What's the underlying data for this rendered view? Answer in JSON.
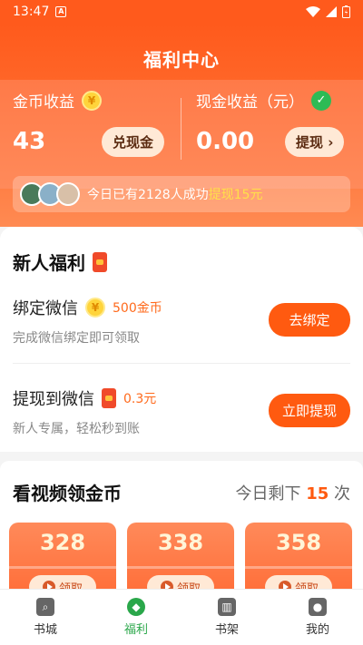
{
  "status": {
    "time": "13:47",
    "sim": "A"
  },
  "header": {
    "title": "福利中心"
  },
  "earnings": {
    "coin_label": "金币收益",
    "coin_value": "43",
    "coin_button": "兑现金",
    "cash_label": "现金收益（元）",
    "cash_value": "0.00",
    "cash_button": "提现 ›"
  },
  "marquee": {
    "text": "今日已有2128人成功",
    "highlight": "提现15元"
  },
  "newbie": {
    "title": "新人福利",
    "tasks": [
      {
        "name": "绑定微信",
        "reward": "500金币",
        "desc": "完成微信绑定即可领取",
        "button": "去绑定"
      },
      {
        "name": "提现到微信",
        "reward": "0.3元",
        "desc": "新人专属，轻松秒到账",
        "button": "立即提现"
      }
    ]
  },
  "video": {
    "title": "看视频领金币",
    "remain_prefix": "今日剩下",
    "remain_count": "15",
    "remain_suffix": "次",
    "cards": [
      {
        "amount": "328",
        "button": "领取"
      },
      {
        "amount": "338",
        "button": "领取"
      },
      {
        "amount": "358",
        "button": "领取"
      }
    ]
  },
  "tabbar": {
    "items": [
      {
        "label": "书城",
        "icon": "search-icon"
      },
      {
        "label": "福利",
        "icon": "gift-icon"
      },
      {
        "label": "书架",
        "icon": "bookshelf-icon"
      },
      {
        "label": "我的",
        "icon": "user-icon"
      }
    ]
  }
}
